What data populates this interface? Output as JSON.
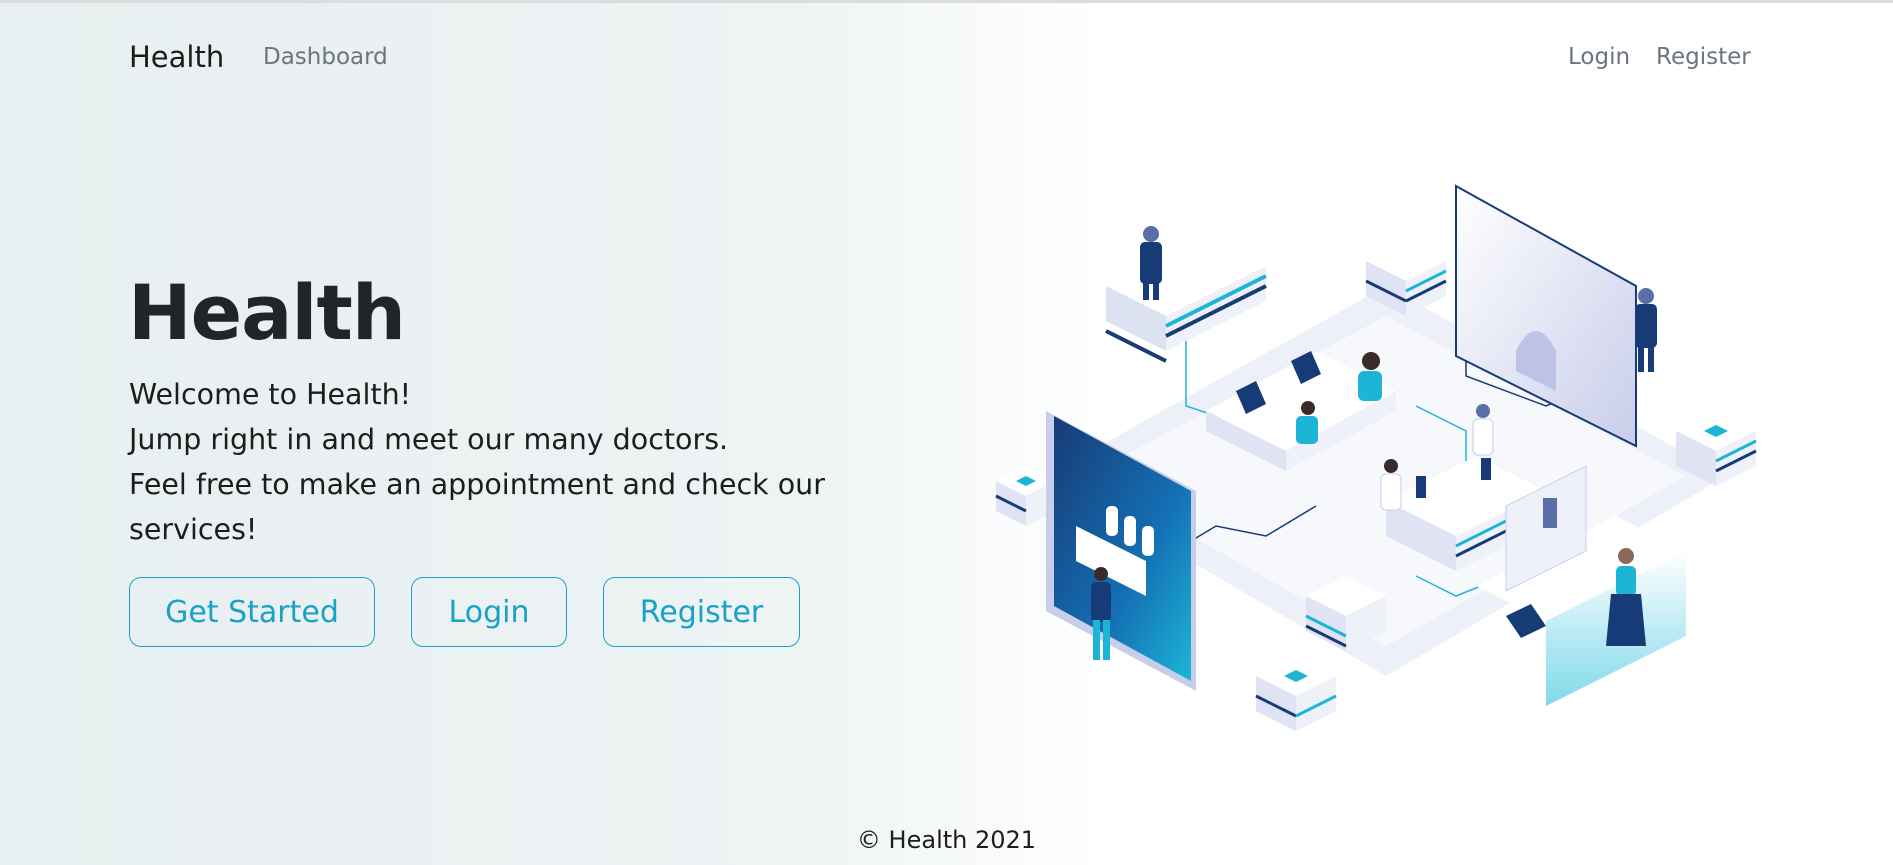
{
  "navbar": {
    "brand": "Health",
    "links": {
      "dashboard": "Dashboard",
      "login": "Login",
      "register": "Register"
    }
  },
  "hero": {
    "title": "Health",
    "lines": [
      "Welcome to Health!",
      "Jump right in and meet our many doctors.",
      "Feel free to make an appointment and check our",
      "services!"
    ],
    "buttons": {
      "get_started": "Get Started",
      "login": "Login",
      "register": "Register"
    },
    "illustration_icon": "isometric-hospital-illustration"
  },
  "footer": {
    "copyright": "© Health 2021"
  },
  "colors": {
    "accent": "#1aa1c7",
    "navy": "#173b76",
    "teal": "#1db5d6",
    "muted": "#6c757d"
  }
}
